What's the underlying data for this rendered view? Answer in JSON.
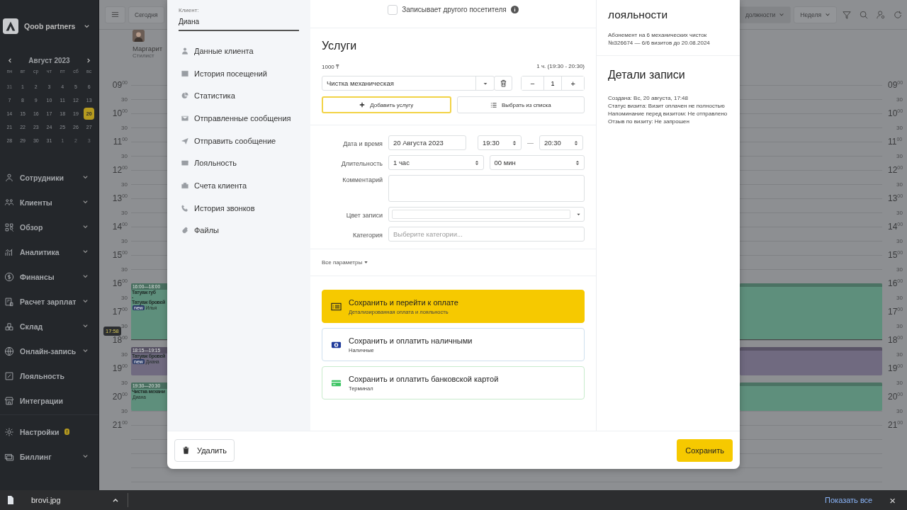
{
  "sidebar": {
    "brand": "Qoob partners",
    "calendar": {
      "month": "Август 2023",
      "weekdays": [
        "пн",
        "вт",
        "ср",
        "чт",
        "пт",
        "сб",
        "вс"
      ],
      "days": [
        {
          "d": "31",
          "muted": true,
          "selected": false
        },
        {
          "d": "1",
          "muted": false,
          "selected": false
        },
        {
          "d": "2",
          "muted": false,
          "selected": false
        },
        {
          "d": "3",
          "muted": false,
          "selected": false
        },
        {
          "d": "4",
          "muted": false,
          "selected": false
        },
        {
          "d": "5",
          "muted": false,
          "selected": false
        },
        {
          "d": "6",
          "muted": false,
          "selected": false
        },
        {
          "d": "7",
          "muted": false,
          "selected": false
        },
        {
          "d": "8",
          "muted": false,
          "selected": false
        },
        {
          "d": "9",
          "muted": false,
          "selected": false
        },
        {
          "d": "10",
          "muted": false,
          "selected": false
        },
        {
          "d": "11",
          "muted": false,
          "selected": false
        },
        {
          "d": "12",
          "muted": false,
          "selected": false
        },
        {
          "d": "13",
          "muted": false,
          "selected": false
        },
        {
          "d": "14",
          "muted": false,
          "selected": false
        },
        {
          "d": "15",
          "muted": false,
          "selected": false
        },
        {
          "d": "16",
          "muted": false,
          "selected": false
        },
        {
          "d": "17",
          "muted": false,
          "selected": false
        },
        {
          "d": "18",
          "muted": false,
          "selected": false
        },
        {
          "d": "19",
          "muted": false,
          "selected": false
        },
        {
          "d": "20",
          "muted": false,
          "selected": true
        },
        {
          "d": "21",
          "muted": false,
          "selected": false
        },
        {
          "d": "22",
          "muted": false,
          "selected": false
        },
        {
          "d": "23",
          "muted": false,
          "selected": false
        },
        {
          "d": "24",
          "muted": false,
          "selected": false
        },
        {
          "d": "25",
          "muted": false,
          "selected": false
        },
        {
          "d": "26",
          "muted": false,
          "selected": false
        },
        {
          "d": "27",
          "muted": false,
          "selected": false
        },
        {
          "d": "28",
          "muted": false,
          "selected": false
        },
        {
          "d": "29",
          "muted": false,
          "selected": false
        },
        {
          "d": "30",
          "muted": false,
          "selected": false
        },
        {
          "d": "31",
          "muted": false,
          "selected": false
        },
        {
          "d": "1",
          "muted": true,
          "selected": false
        },
        {
          "d": "2",
          "muted": true,
          "selected": false
        },
        {
          "d": "3",
          "muted": true,
          "selected": false
        }
      ]
    },
    "nav": [
      {
        "label": "Сотрудники",
        "expandable": true
      },
      {
        "label": "Клиенты",
        "expandable": true
      },
      {
        "label": "Обзор",
        "expandable": true
      },
      {
        "label": "Аналитика",
        "expandable": true
      },
      {
        "label": "Финансы",
        "expandable": true
      },
      {
        "label": "Расчет зарплат",
        "expandable": true
      },
      {
        "label": "Склад",
        "expandable": true
      },
      {
        "label": "Онлайн-запись",
        "expandable": true
      },
      {
        "label": "Лояльность",
        "expandable": false
      },
      {
        "label": "Интеграции",
        "expandable": false
      }
    ],
    "bottom_nav": [
      {
        "label": "Настройки",
        "expandable": false,
        "badge": "!"
      },
      {
        "label": "Биллинг",
        "expandable": true
      }
    ]
  },
  "calendar": {
    "today": "Сегодня",
    "position_filter": "должности",
    "view": "Неделя",
    "staff": {
      "name": "Маргарит",
      "role": "Стилист"
    },
    "time_left": [
      {
        "hour": "09",
        "minutes": "00"
      },
      {
        "minutes": "30"
      },
      {
        "hour": "10",
        "minutes": "00"
      },
      {
        "minutes": "30"
      },
      {
        "hour": "11",
        "minutes": "00"
      },
      {
        "minutes": "30"
      },
      {
        "hour": "12",
        "minutes": "00"
      },
      {
        "minutes": "30"
      },
      {
        "hour": "13",
        "minutes": "00"
      },
      {
        "minutes": "30"
      },
      {
        "hour": "14",
        "minutes": "00"
      },
      {
        "minutes": "30"
      },
      {
        "hour": "15",
        "minutes": "00"
      },
      {
        "minutes": "30"
      },
      {
        "hour": "16",
        "minutes": "00"
      },
      {
        "minutes": "30"
      },
      {
        "hour": "17",
        "minutes": "00"
      },
      {
        "minutes": "30"
      },
      {
        "hour": "18",
        "minutes": "00"
      },
      {
        "minutes": "30"
      },
      {
        "hour": "19",
        "minutes": "00"
      },
      {
        "minutes": "30"
      },
      {
        "hour": "20",
        "minutes": "00"
      },
      {
        "minutes": "30"
      },
      {
        "hour": "21",
        "minutes": "00"
      }
    ],
    "time_right": [
      {
        "hour": "09",
        "minutes": "00"
      },
      {
        "minutes": "30"
      },
      {
        "hour": "10",
        "minutes": "00"
      },
      {
        "minutes": "30"
      },
      {
        "hour": "11",
        "minutes": "00"
      },
      {
        "minutes": "30"
      },
      {
        "hour": "12",
        "minutes": "00"
      },
      {
        "minutes": "30"
      },
      {
        "hour": "13",
        "minutes": "00"
      },
      {
        "minutes": "30"
      },
      {
        "hour": "14",
        "minutes": "00"
      },
      {
        "minutes": "30"
      },
      {
        "hour": "15",
        "minutes": "00"
      },
      {
        "minutes": "30"
      },
      {
        "hour": "16",
        "minutes": "00"
      },
      {
        "minutes": "30"
      },
      {
        "hour": "17",
        "minutes": "00"
      },
      {
        "minutes": "30"
      },
      {
        "hour": "18",
        "minutes": "00"
      },
      {
        "minutes": "30"
      },
      {
        "hour": "19",
        "minutes": "00"
      },
      {
        "minutes": "30"
      },
      {
        "hour": "20",
        "minutes": "00"
      },
      {
        "minutes": "30"
      },
      {
        "hour": "21",
        "minutes": "00"
      }
    ],
    "events": [
      {
        "time": "16:00—18:00",
        "lines": [
          "Татуаж губ",
          "-",
          "Татуаж бровей"
        ],
        "badge": "new",
        "client": "Илья",
        "color": "#5e8f7c"
      },
      {
        "time": "18:15—19:15",
        "lines": [
          "Татуаж бровей"
        ],
        "badge": "new",
        "client": "Диана",
        "color": "#706a80"
      },
      {
        "time": "19:30—20:30",
        "lines": [
          "Чистка механи"
        ],
        "client": "Диана",
        "color": "#5e8f7c"
      }
    ],
    "now": "17:58"
  },
  "modal": {
    "client": {
      "label": "Клиент:",
      "name": "Диана"
    },
    "client_menu": [
      "Данные клиента",
      "История посещений",
      "Статистика",
      "Отправленные сообщения",
      "Отправить сообщение",
      "Лояльность",
      "Счета клиента",
      "История звонков",
      "Файлы"
    ],
    "other_visitor": {
      "label": "Записывает другого посетителя",
      "checked": false
    },
    "services": {
      "title": "Услуги",
      "price": "1000 ₸",
      "duration": "1 ч. (19:30 - 20:30)",
      "service": "Чистка механическая",
      "minus": "−",
      "quantity": "1",
      "plus": "+",
      "add_button": "Добавить услугу",
      "list_button": "Выбрать из списка"
    },
    "form": {
      "date_label": "Дата и время",
      "date": "20 Августа 2023",
      "start": "19:30",
      "dash": "—",
      "end": "20:30",
      "duration_label": "Длительность",
      "hours": "1 час",
      "minutes": "00 мин",
      "comment_label": "Комментарий",
      "color_label": "Цвет записи",
      "category_label": "Категория",
      "category_placeholder": "Выберите категории..."
    },
    "all_params": "Все параметры",
    "payment_options": [
      {
        "title": "Сохранить и перейти к оплате",
        "subtitle": "Детализированная оплата и лояльность",
        "primary": true
      },
      {
        "title": "Сохранить и оплатить наличными",
        "subtitle": "Наличные",
        "primary": false
      },
      {
        "title": "Сохранить и оплатить банковской картой",
        "subtitle": "Терминал",
        "primary": false
      }
    ],
    "loyalty": {
      "title": "лояльности",
      "text": "Абонемент на 6 механических чисток №326674 — 6/6 визитов до 20.08.2024"
    },
    "details": {
      "title": "Детали записи",
      "lines": [
        "Создана: Вс, 20 августа, 17:48",
        "Статус визита: Визит оплачен не полностью",
        "Напоминание перед визитом: Не отправлено",
        "Отзыв по визиту: Не запрошен"
      ]
    },
    "footer": {
      "delete": "Удалить",
      "save": "Сохранить"
    }
  },
  "download_bar": {
    "file": "brovi.jpg",
    "show_all": "Показать все",
    "close": "×"
  }
}
